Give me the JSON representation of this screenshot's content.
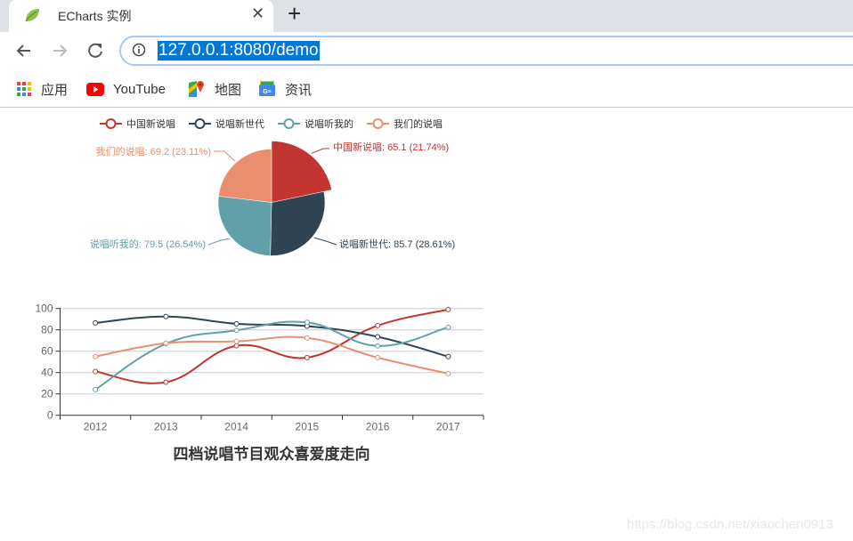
{
  "browser": {
    "tab_title": "ECharts 实例",
    "tab_icon": "spring-leaf-icon",
    "close_icon": "close-icon",
    "new_tab_icon": "plus-icon",
    "url": "127.0.0.1:8080/demo",
    "nav": [
      "back-icon",
      "forward-icon",
      "reload-icon"
    ],
    "bookmarks": [
      {
        "label": "应用",
        "icon": "apps-grid-icon"
      },
      {
        "label": "YouTube",
        "icon": "youtube-icon"
      },
      {
        "label": "地图",
        "icon": "maps-icon"
      },
      {
        "label": "资讯",
        "icon": "news-icon"
      }
    ]
  },
  "colors": {
    "series": [
      "#c23531",
      "#2f4554",
      "#61a0a8",
      "#e98f6f"
    ],
    "axis": "#666666",
    "grid": "#cccccc",
    "title": "#333333"
  },
  "chart_data": [
    {
      "type": "pie",
      "legend": [
        "中国新说唱",
        "说唱新世代",
        "说唱听我的",
        "我们的说唱"
      ],
      "legend_position": "top-center",
      "slices": [
        {
          "name": "中国新说唱",
          "value": 65.1,
          "percent": "21.74%",
          "label": "中国新说唱: 65.1 (21.74%)",
          "emphasized": true
        },
        {
          "name": "说唱新世代",
          "value": 85.7,
          "percent": "28.61%",
          "label": "说唱新世代: 85.7 (28.61%)"
        },
        {
          "name": "说唱听我的",
          "value": 79.5,
          "percent": "26.54%",
          "label": "说唱听我的: 79.5 (26.54%)"
        },
        {
          "name": "我们的说唱",
          "value": 69.2,
          "percent": "23.11%",
          "label": "我们的说唱: 69.2 (23.11%)"
        }
      ]
    },
    {
      "type": "line",
      "smooth": true,
      "title": "四档说唱节目观众喜爱度走向",
      "title_position": "bottom-center",
      "categories": [
        "2012",
        "2013",
        "2014",
        "2015",
        "2016",
        "2017"
      ],
      "ylim": [
        0,
        100
      ],
      "yticks": [
        "0",
        "20",
        "40",
        "60",
        "80",
        "100"
      ],
      "grid": true,
      "series": [
        {
          "name": "中国新说唱",
          "values": [
            41,
            31,
            65.1,
            54,
            84,
            99
          ]
        },
        {
          "name": "说唱新世代",
          "values": [
            86.5,
            92.5,
            85.7,
            83.5,
            73.5,
            55
          ]
        },
        {
          "name": "说唱听我的",
          "values": [
            24,
            67,
            79.5,
            87,
            65,
            82.5
          ]
        },
        {
          "name": "我们的说唱",
          "values": [
            55,
            67.5,
            69.2,
            72.5,
            54,
            39
          ]
        }
      ]
    }
  ],
  "watermark": "https://blog.csdn.net/xiaochen0913"
}
